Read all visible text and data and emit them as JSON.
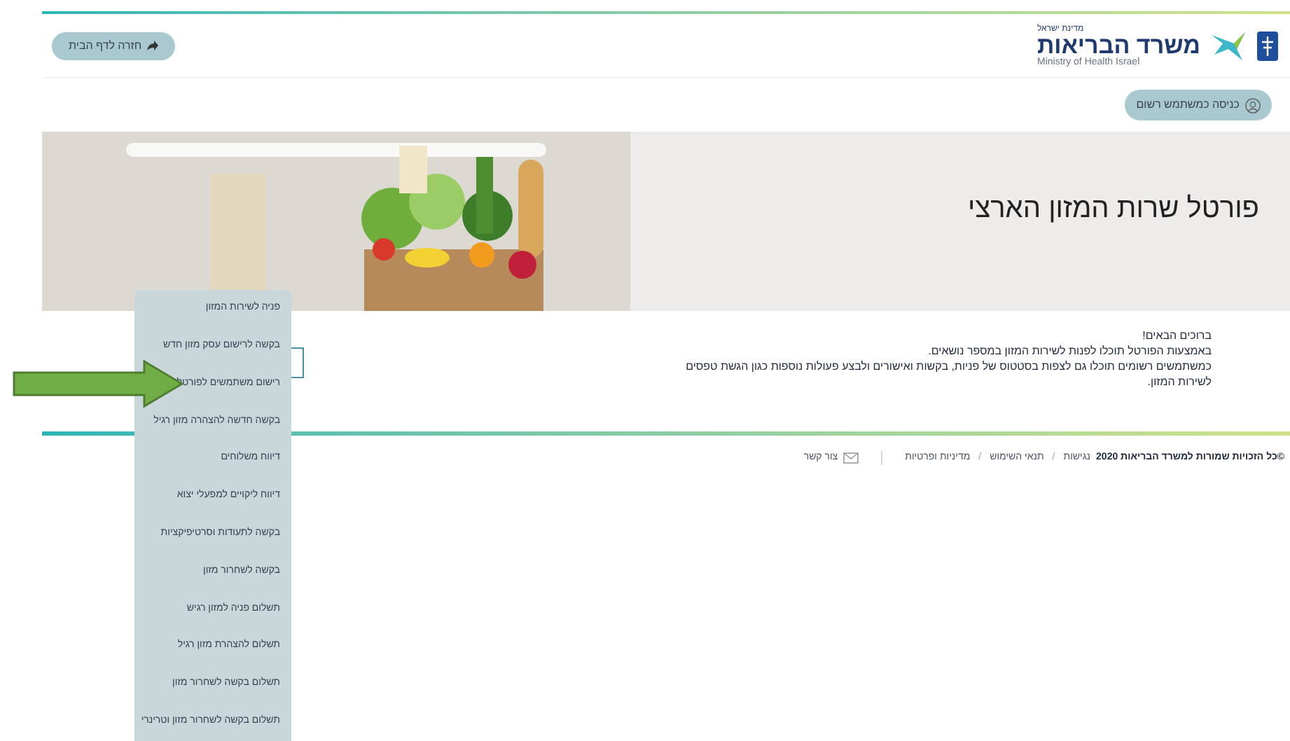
{
  "header": {
    "logo": {
      "state": "מדינת ישראל",
      "ministry": "משרד הבריאות",
      "english": "Ministry of Health Israel"
    },
    "back_button": "חזרה לדף הבית"
  },
  "login_button": "כניסה כמשתמש רשום",
  "hero": {
    "title": "פורטל שרות המזון הארצי"
  },
  "welcome": {
    "greeting": "ברוכים הבאים!",
    "lines": [
      "באמצעות הפורטל תוכלו לפנות לשירות המזון במספר נושאים.",
      "כמשתמשים רשומים תוכלו גם לצפות בסטטוס של פניות, בקשות ואישורים ולבצע פעולות נוספות כגון הגשת טפסים לשירות המזון."
    ]
  },
  "menu": {
    "items": [
      {
        "label": "פניה לשירות המזון"
      },
      {
        "label": "בקשה לרישום עסק מזון חדש"
      },
      {
        "label": "רישום משתמשים לפורטל"
      },
      {
        "label": "בקשה חדשה להצהרה מזון רגיל"
      },
      {
        "label": "דיווח משלוחים"
      },
      {
        "label": "דיווח ליקויים למפעלי יצוא"
      },
      {
        "label": "בקשה לתעודות וסרטיפיקציות"
      },
      {
        "label": "בקשה לשחרור מזון"
      },
      {
        "label": "תשלום פניה למזון רגיש"
      },
      {
        "label": "תשלום להצהרת מזון רגיל"
      },
      {
        "label": "תשלום בקשה לשחרור מזון"
      },
      {
        "label": "תשלום בקשה לשחרור מזון וטרינרי"
      }
    ]
  },
  "footer": {
    "copyright": "©כל הזכויות שמורות למשרד הבריאות 2020",
    "links": [
      {
        "kind": "link",
        "text": "נגישות"
      },
      {
        "kind": "separator",
        "text": "/"
      },
      {
        "kind": "link",
        "text": "תנאי השימוש"
      },
      {
        "kind": "separator",
        "text": "/"
      },
      {
        "kind": "link",
        "text": "מדיניות ופרטיות"
      }
    ],
    "contact": "צור קשר"
  }
}
